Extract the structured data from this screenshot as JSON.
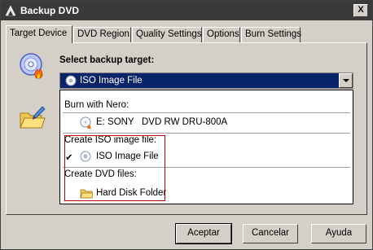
{
  "window": {
    "title": "Backup DVD",
    "close_label": "X"
  },
  "tabs": [
    {
      "label": "Target Device"
    },
    {
      "label": "DVD Region"
    },
    {
      "label": "Quality Settings"
    },
    {
      "label": "Options"
    },
    {
      "label": "Burn Settings"
    }
  ],
  "main": {
    "select_label": "Select backup target:",
    "combo_value": "ISO Image File"
  },
  "dropdown": {
    "header_burn": "Burn with Nero:",
    "drive_label": "E: SONY",
    "drive_model": "DVD RW DRU-800A",
    "header_iso": "Create ISO image file:",
    "iso_item": "ISO Image File",
    "checkmark": "✔",
    "header_dvd": "Create DVD files:",
    "folder_item": "Hard Disk Folder"
  },
  "buttons": {
    "ok": "Aceptar",
    "cancel": "Cancelar",
    "help": "Ayuda"
  },
  "colors": {
    "selection": "#0a246a",
    "highlight_box": "#b50000",
    "face": "#d4d0c8"
  },
  "icons": [
    "dvd-backup-icon",
    "close-icon",
    "dvd-flame-icon",
    "folder-edit-icon",
    "disc-icon",
    "folder-icon",
    "chevron-down-icon",
    "checkmark-icon"
  ]
}
